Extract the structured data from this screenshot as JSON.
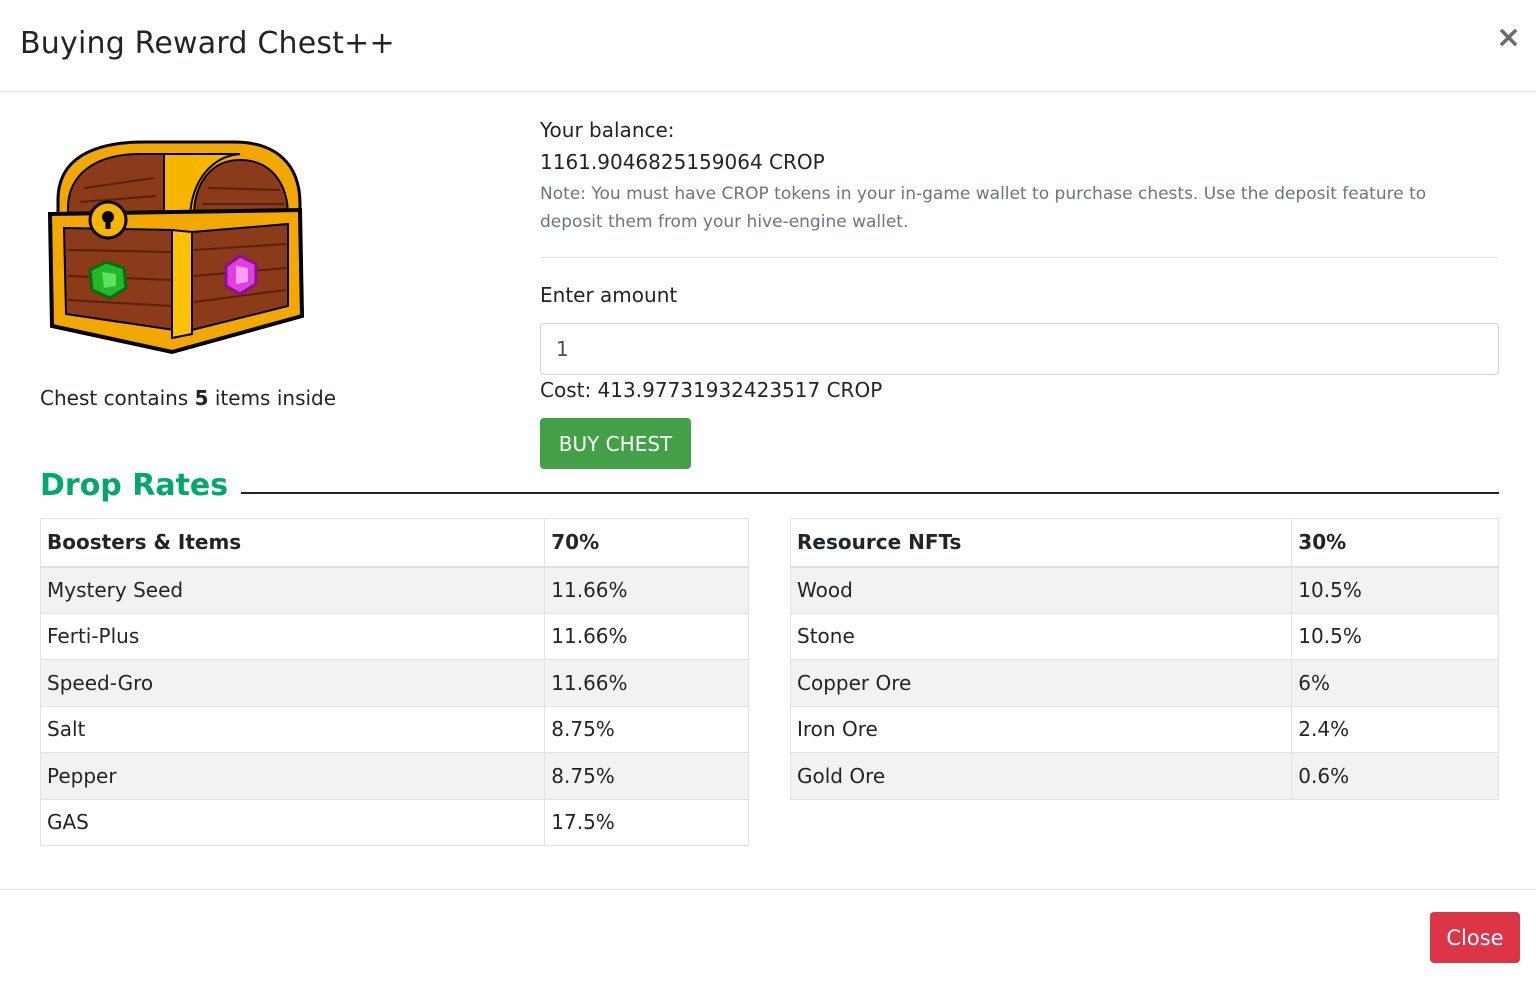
{
  "modal": {
    "title": "Buying Reward Chest++",
    "close_x": "×"
  },
  "chest": {
    "caption_prefix": "Chest contains ",
    "item_count": "5",
    "caption_suffix": " items inside"
  },
  "purchase": {
    "balance_label": "Your balance:",
    "balance_value": "1161.9046825159064 CROP",
    "note": "Note: You must have CROP tokens in your in-game wallet to purchase chests. Use the deposit feature to deposit them from your hive-engine wallet.",
    "amount_label": "Enter amount",
    "amount_value": "1",
    "cost": "Cost: 413.97731932423517 CROP",
    "buy_label": "BUY CHEST"
  },
  "drop_rates": {
    "title": "Drop Rates",
    "boosters": {
      "header_name": "Boosters & Items",
      "header_pct": "70%",
      "rows": [
        {
          "name": "Mystery Seed",
          "pct": "11.66%"
        },
        {
          "name": "Ferti-Plus",
          "pct": "11.66%"
        },
        {
          "name": "Speed-Gro",
          "pct": "11.66%"
        },
        {
          "name": "Salt",
          "pct": "8.75%"
        },
        {
          "name": "Pepper",
          "pct": "8.75%"
        },
        {
          "name": "GAS",
          "pct": "17.5%"
        }
      ]
    },
    "resources": {
      "header_name": "Resource NFTs",
      "header_pct": "30%",
      "rows": [
        {
          "name": "Wood",
          "pct": "10.5%"
        },
        {
          "name": "Stone",
          "pct": "10.5%"
        },
        {
          "name": "Copper Ore",
          "pct": "6%"
        },
        {
          "name": "Iron Ore",
          "pct": "2.4%"
        },
        {
          "name": "Gold Ore",
          "pct": "0.6%"
        }
      ]
    }
  },
  "footer": {
    "close_label": "Close"
  },
  "colors": {
    "accent_green": "#00a86b",
    "buy_button": "#43a047",
    "close_button": "#dc3545"
  }
}
